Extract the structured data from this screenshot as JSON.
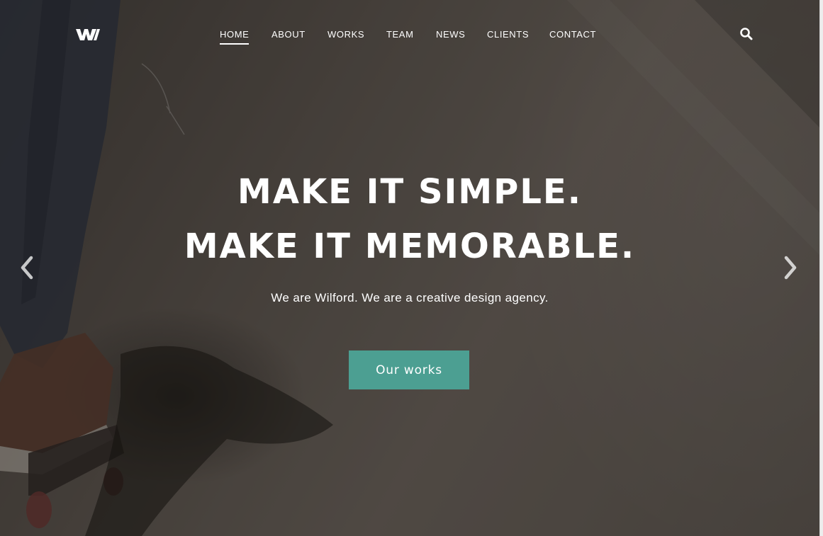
{
  "brand": {
    "logo_text": "W",
    "logo_icon": "wilford-logo-icon"
  },
  "nav": {
    "items": [
      {
        "label": "HOME",
        "active": true
      },
      {
        "label": "ABOUT",
        "active": false
      },
      {
        "label": "WORKS",
        "active": false
      },
      {
        "label": "TEAM",
        "active": false
      },
      {
        "label": "NEWS",
        "active": false
      },
      {
        "label": "CLIENTS",
        "active": false
      },
      {
        "label": "CONTACT",
        "active": false
      }
    ],
    "search_icon": "search-icon"
  },
  "hero": {
    "headline_line1": "MAKE IT SIMPLE.",
    "headline_line2": "MAKE IT MEMORABLE.",
    "subline": "We are Wilford. We are a creative design agency.",
    "cta_label": "Our works",
    "prev_icon": "chevron-left-icon",
    "next_icon": "chevron-right-icon"
  },
  "colors": {
    "accent": "#4c9f92",
    "text": "#ffffff",
    "overlay": "#1e1a18"
  }
}
